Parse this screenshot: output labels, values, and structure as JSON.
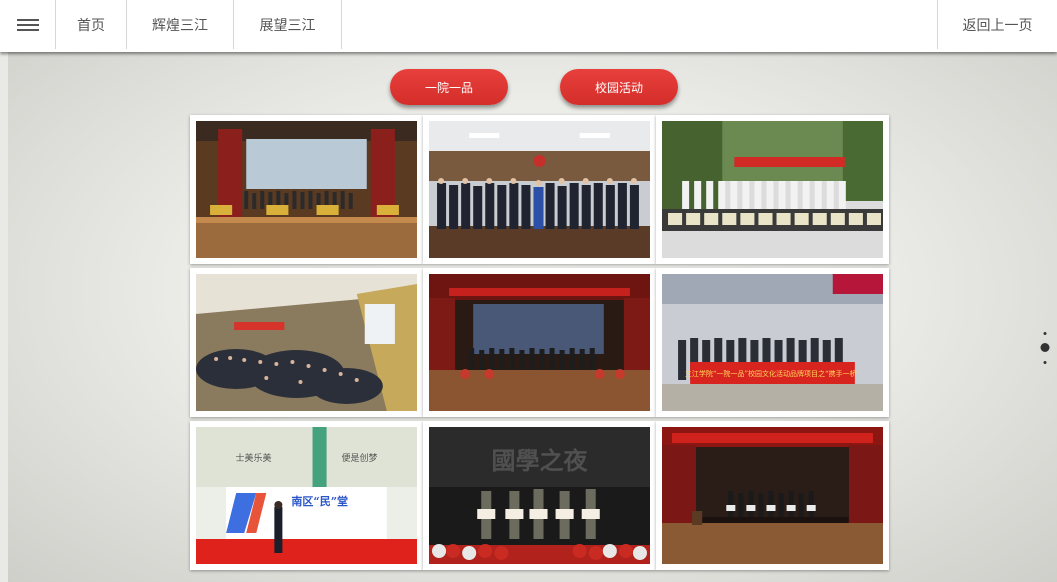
{
  "nav": {
    "home": "首页",
    "glory": "辉煌三江",
    "future": "展望三江",
    "back": "返回上一页"
  },
  "tabs": {
    "one_college": "一院一品",
    "campus_activities": "校园活动"
  },
  "photos": {
    "p2": {
      "banner": "三江学院“一院一品”校园文化活动品牌项目之“携手一桥”"
    },
    "p7": {
      "title": "南区“民”堂",
      "slogan_left": "士美乐美",
      "slogan_right": "便是创梦"
    },
    "p8": {
      "title": "國學之夜"
    }
  },
  "colors": {
    "accent_red": "#d93330",
    "nav_text": "#555555"
  }
}
